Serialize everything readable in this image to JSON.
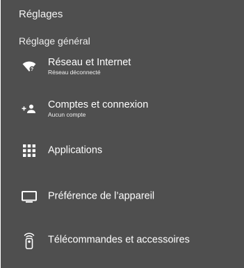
{
  "header": {
    "title": "Réglages",
    "section": "Réglage général"
  },
  "items": [
    {
      "label": "Réseau et Internet",
      "sub": "Réseau déconnecté",
      "icon": "wifi-off-icon"
    },
    {
      "label": "Comptes et connexion",
      "sub": "Aucun compte",
      "icon": "add-account-icon"
    },
    {
      "label": "Applications",
      "sub": "",
      "icon": "apps-grid-icon"
    },
    {
      "label": "Préférence de l’appareil",
      "sub": "",
      "icon": "tv-icon"
    },
    {
      "label": "Télécommandes et accessoires",
      "sub": "",
      "icon": "remote-icon"
    }
  ],
  "colors": {
    "background": "#4f4f4f",
    "text": "#ffffff"
  }
}
